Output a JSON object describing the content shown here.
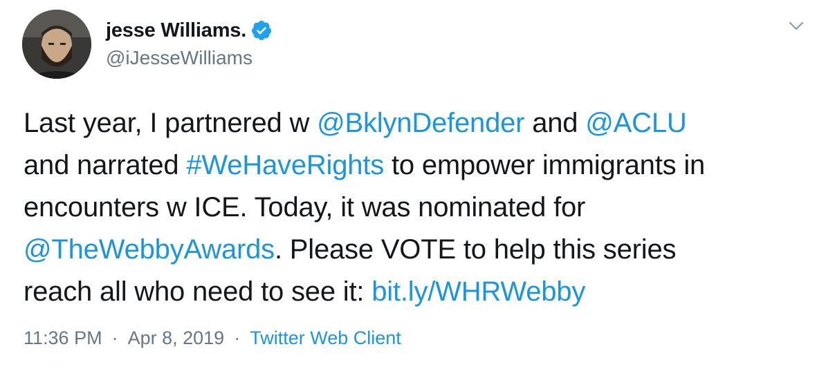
{
  "author": {
    "display_name": "jesse Williams.",
    "handle": "@iJesseWilliams",
    "verified": true,
    "avatar_icon": "profile-photo"
  },
  "tweet": {
    "lines": [
      [
        {
          "text": "Last year, I partnered w ",
          "type": "text"
        },
        {
          "text": "@BklynDefender",
          "type": "mention"
        },
        {
          "text": " and ",
          "type": "text"
        },
        {
          "text": "@ACLU",
          "type": "mention"
        }
      ],
      [
        {
          "text": "and narrated ",
          "type": "text"
        },
        {
          "text": "#WeHaveRights",
          "type": "hashtag"
        },
        {
          "text": " to empower immigrants in",
          "type": "text"
        }
      ],
      [
        {
          "text": "encounters w ICE. Today, it was nominated for",
          "type": "text"
        }
      ],
      [
        {
          "text": "@TheWebbyAwards",
          "type": "mention"
        },
        {
          "text": ". Please VOTE to help this series",
          "type": "text"
        }
      ],
      [
        {
          "text": "reach all who need to see it: ",
          "type": "text"
        },
        {
          "text": "bit.ly/WHRWebby",
          "type": "url"
        }
      ]
    ]
  },
  "meta": {
    "time": "11:36 PM",
    "separator": "·",
    "date": "Apr 8, 2019",
    "client": "Twitter Web Client"
  },
  "colors": {
    "link": "#1b95e0",
    "verified": "#1da1f2",
    "secondary_text": "#657786",
    "primary_text": "#14171a"
  },
  "icons": {
    "verified": "verified-badge-icon",
    "caret": "chevron-down-icon"
  }
}
